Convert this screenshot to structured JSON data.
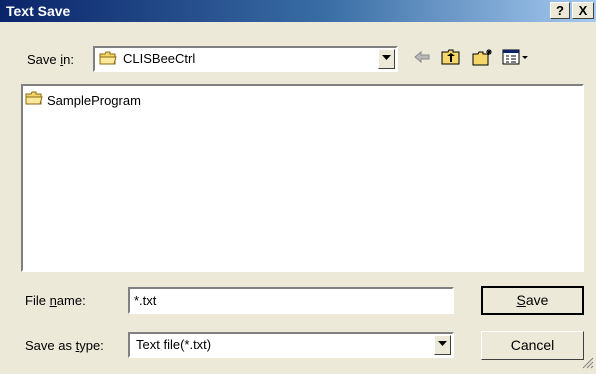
{
  "window": {
    "title": "Text Save",
    "help_label": "?",
    "close_label": "X"
  },
  "toolbar": {
    "save_in_prefix": "Save ",
    "save_in_accel": "i",
    "save_in_suffix": "n:",
    "current_folder": "CLISBeeCtrl",
    "icons": [
      "back-arrow-icon",
      "up-folder-icon",
      "new-folder-icon",
      "view-menu-icon"
    ]
  },
  "file_list": {
    "items": [
      {
        "name": "SampleProgram",
        "type": "folder"
      }
    ]
  },
  "file_name": {
    "label_prefix": "File ",
    "label_accel": "n",
    "label_suffix": "ame:",
    "value": "*.txt"
  },
  "save_as_type": {
    "label_prefix": "Save as ",
    "label_accel": "t",
    "label_suffix": "ype:",
    "value": "Text file(*.txt)"
  },
  "buttons": {
    "save_accel": "S",
    "save_rest": "ave",
    "cancel": "Cancel"
  },
  "colors": {
    "title_start": "#0a246a",
    "title_end": "#a6caf0",
    "dialog_bg": "#ece9d8",
    "folder_yellow": "#f5d66a"
  }
}
